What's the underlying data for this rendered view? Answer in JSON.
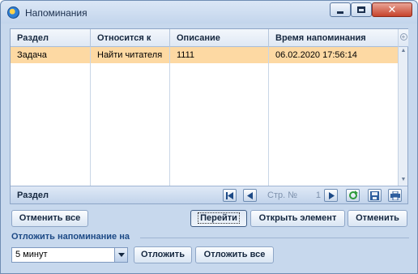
{
  "window": {
    "title": "Напоминания"
  },
  "grid": {
    "columns": [
      "Раздел",
      "Относится к",
      "Описание",
      "Время напоминания"
    ],
    "rows": [
      {
        "section": "Задача",
        "related_to": "Найти читателя",
        "description": "1111",
        "remind_time": "06.02.2020 17:56:14"
      }
    ],
    "footer_label": "Раздел",
    "pager": {
      "page_prefix": "Стр. №",
      "page_number": "1"
    }
  },
  "buttons": {
    "cancel_all": "Отменить все",
    "go": "Перейти",
    "open_item": "Открыть элемент",
    "cancel": "Отменить",
    "postpone": "Отложить",
    "postpone_all": "Отложить все"
  },
  "postpone": {
    "label": "Отложить напоминание на",
    "selected": "5 минут"
  },
  "colors": {
    "row_highlight": "#fdd9a3",
    "accent": "#1d4a86"
  }
}
